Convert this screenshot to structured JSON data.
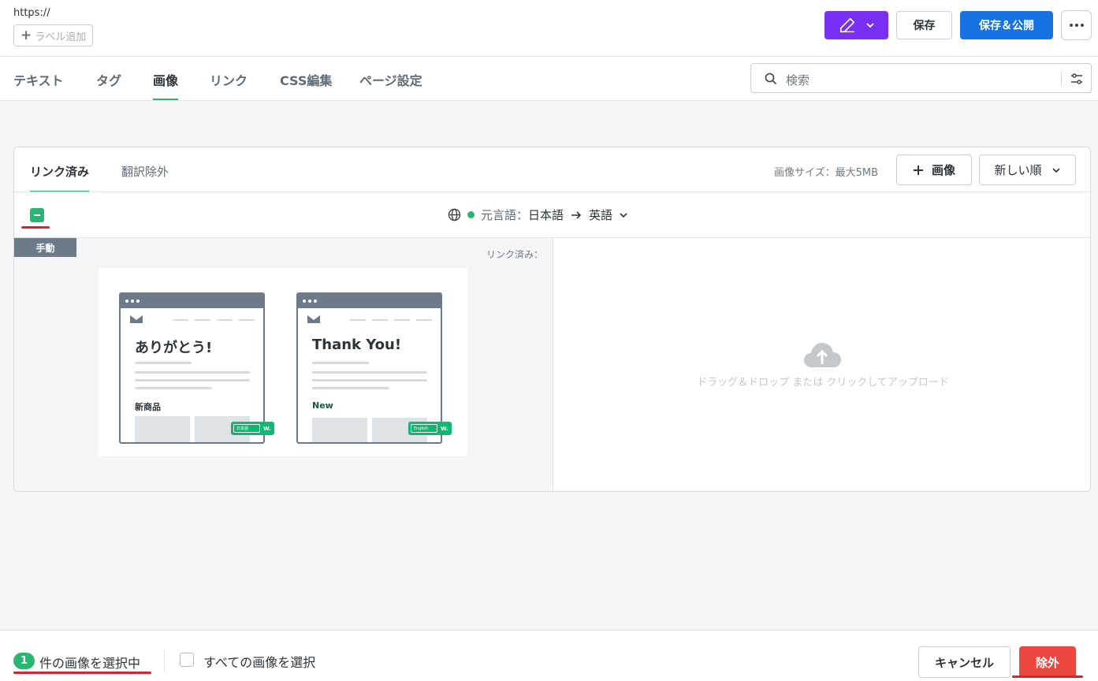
{
  "header": {
    "url": "https://",
    "add_label": "ラベル追加",
    "save": "保存",
    "save_publish": "保存＆公開"
  },
  "tabs": [
    "テキスト",
    "タグ",
    "画像",
    "リンク",
    "CSS編集",
    "ページ設定"
  ],
  "active_tab": "画像",
  "search": {
    "placeholder": "検索"
  },
  "panel": {
    "tabs": [
      "リンク済み",
      "翻訳除外"
    ],
    "size_note": "画像サイズ：最大5MB",
    "add_image": "画像",
    "sort": "新しい順",
    "source_label": "元言語：",
    "source_lang": "日本語",
    "target_lang": "英語",
    "manual_badge": "手動",
    "linked_label": "リンク済み：",
    "upload_hint": "ドラッグ＆ドロップ または クリックしてアップロード"
  },
  "thumbnail": {
    "left": {
      "title": "ありがとう!",
      "sub": "新商品",
      "lang": "日本語"
    },
    "right": {
      "title": "Thank You!",
      "sub": "New",
      "lang": "English"
    },
    "badge_letter": "W."
  },
  "footer": {
    "selected_count": "1",
    "selected_text": "件の画像を選択中",
    "select_all": "すべての画像を選択",
    "cancel": "キャンセル",
    "exclude": "除外"
  },
  "colors": {
    "accent_green": "#2ab672",
    "primary_blue": "#1672e3",
    "purple": "#7b2ff3",
    "danger": "#e9473f"
  }
}
